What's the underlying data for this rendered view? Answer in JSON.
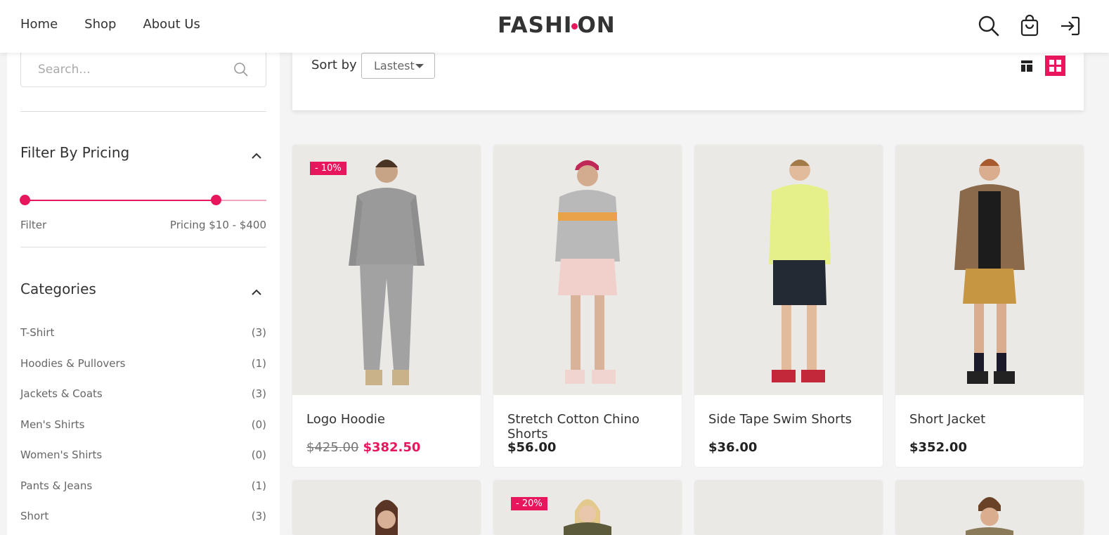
{
  "header": {
    "nav": [
      "Home",
      "Shop",
      "About Us"
    ],
    "logo_left": "FASH",
    "logo_i": "I",
    "logo_right": "ON",
    "icons": [
      "search-icon",
      "cart-icon",
      "login-icon"
    ]
  },
  "sidebar": {
    "search_placeholder": "Search...",
    "pricing_title": "Filter By Pricing",
    "price_range": {
      "min": 10,
      "max": 400,
      "lower_fraction": 0.0,
      "upper_fraction": 0.79
    },
    "filter_label": "Filter",
    "pricing_text": "Pricing $10 - $400",
    "categories_title": "Categories",
    "categories": [
      {
        "name": "T-Shirt",
        "count": "(3)"
      },
      {
        "name": "Hoodies & Pullovers",
        "count": "(1)"
      },
      {
        "name": "Jackets & Coats",
        "count": "(3)"
      },
      {
        "name": "Men's Shirts",
        "count": "(0)"
      },
      {
        "name": "Women's Shirts",
        "count": "(0)"
      },
      {
        "name": "Pants & Jeans",
        "count": "(1)"
      },
      {
        "name": "Short",
        "count": "(3)"
      }
    ]
  },
  "toolbar": {
    "sort_label": "Sort by",
    "sort_value": "Lastest"
  },
  "products": [
    {
      "name": "Logo Hoodie",
      "old_price": "$425.00",
      "price": "$382.50",
      "badge": "- 10%"
    },
    {
      "name": "Stretch Cotton Chino Shorts",
      "old_price": "",
      "price": "$56.00",
      "badge": ""
    },
    {
      "name": "Side Tape Swim Shorts",
      "old_price": "",
      "price": "$36.00",
      "badge": ""
    },
    {
      "name": "Short Jacket",
      "old_price": "",
      "price": "$352.00",
      "badge": ""
    }
  ],
  "second_row": [
    {
      "badge": ""
    },
    {
      "badge": "- 20%"
    },
    {
      "badge": ""
    },
    {
      "badge": ""
    }
  ],
  "colors": {
    "accent": "#e8175d",
    "image_bg": "#ebe9e6"
  }
}
